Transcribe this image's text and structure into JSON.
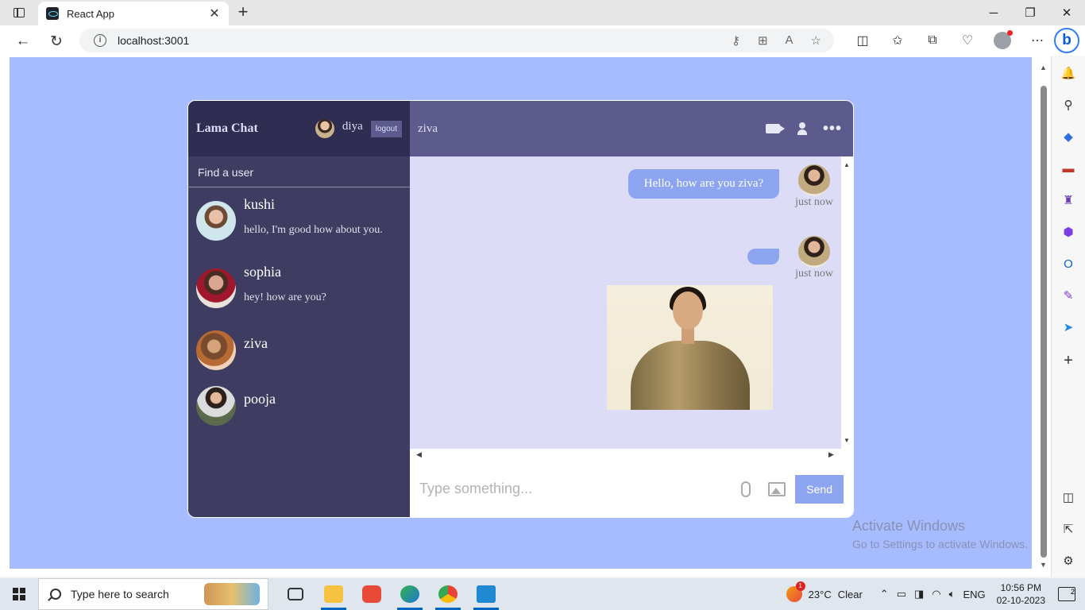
{
  "browser": {
    "tab_title": "React App",
    "tab_close": "✕",
    "new_tab": "+",
    "url": "localhost:3001",
    "window_controls": [
      "─",
      "❐",
      "✕"
    ]
  },
  "app": {
    "logo": "Lama Chat",
    "current_user": "diya",
    "logout_label": "logout",
    "search_placeholder": "Find a user",
    "users": [
      {
        "name": "kushi",
        "last_message": "hello, I'm good how about you."
      },
      {
        "name": "sophia",
        "last_message": "hey! how are you?"
      },
      {
        "name": "ziva",
        "last_message": ""
      },
      {
        "name": "pooja",
        "last_message": ""
      }
    ],
    "chat": {
      "contact": "ziva",
      "messages": [
        {
          "text": "Hello, how are you ziva?",
          "time": "just now",
          "has_image": false
        },
        {
          "text": "",
          "time": "just now",
          "has_image": true
        }
      ]
    },
    "input": {
      "placeholder": "Type something...",
      "send_label": "Send"
    }
  },
  "watermark": {
    "line1": "Activate Windows",
    "line2": "Go to Settings to activate Windows."
  },
  "taskbar": {
    "search_text": "Type here to search",
    "weather_temp": "23°C",
    "weather_desc": "Clear",
    "language": "ENG",
    "time": "10:56 PM",
    "date": "02-10-2023",
    "notification_count": "2"
  },
  "colors": {
    "page_bg": "#a7bcff",
    "sidebar": "#3e3c61",
    "sidebar_nav": "#2f2d52",
    "chat_nav": "#5d5b8d",
    "chat_bg": "#dddcf7",
    "bubble": "#8da4f1"
  }
}
